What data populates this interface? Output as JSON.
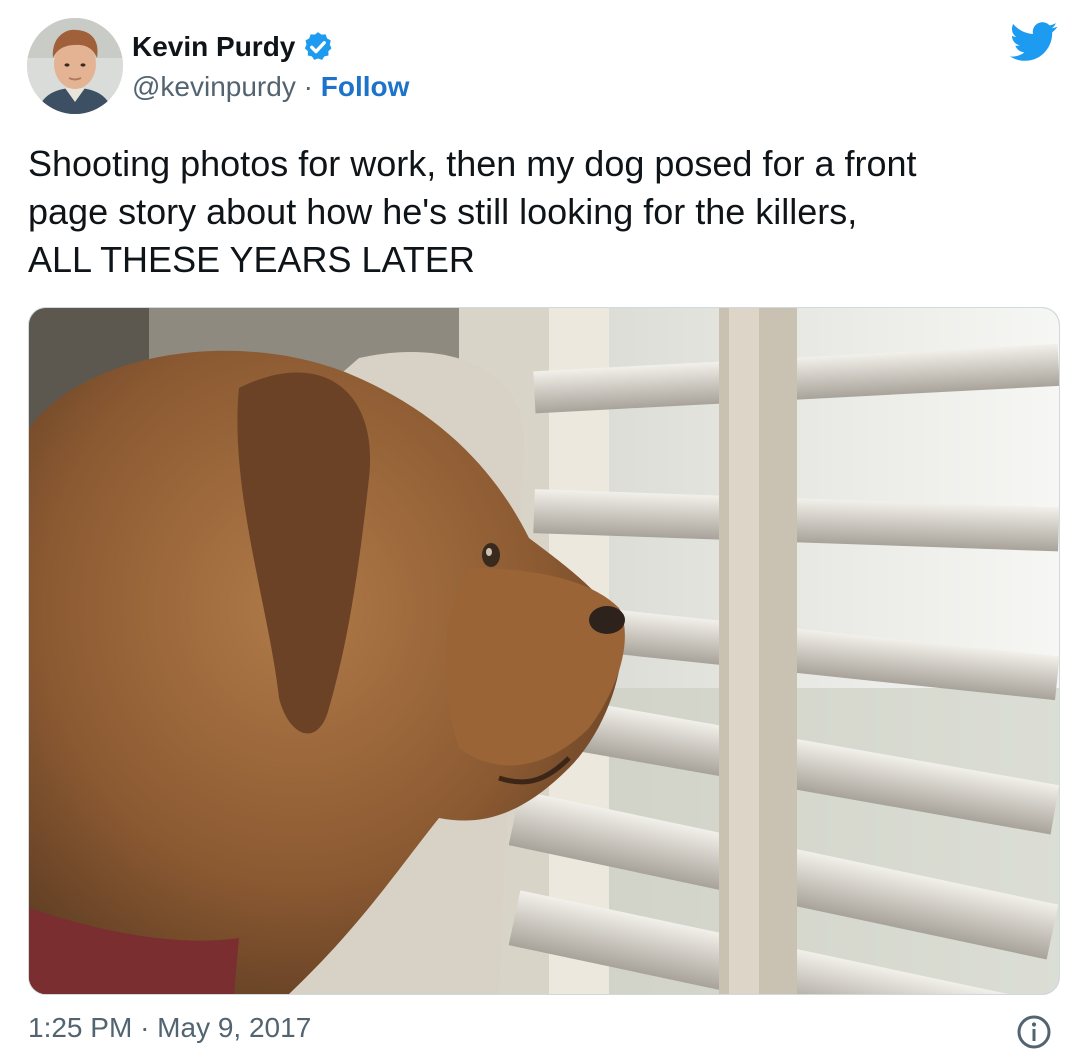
{
  "author": {
    "name": "Kevin Purdy",
    "handle": "@kevinpurdy",
    "separator": "·",
    "follow_label": "Follow",
    "verified": true
  },
  "icons": {
    "brand": "twitter-bird-icon",
    "verified": "verified-badge-icon",
    "info": "info-icon"
  },
  "tweet": {
    "lines": [
      "Shooting photos for work, then my dog posed for a front",
      "page story about how he's still looking for the killers,",
      "ALL THESE YEARS LATER"
    ]
  },
  "footer": {
    "time": "1:25 PM",
    "separator": "·",
    "date": "May 9, 2017"
  },
  "colors": {
    "link": "#1d72c9",
    "brand": "#1d9bf0",
    "muted": "#536471"
  }
}
